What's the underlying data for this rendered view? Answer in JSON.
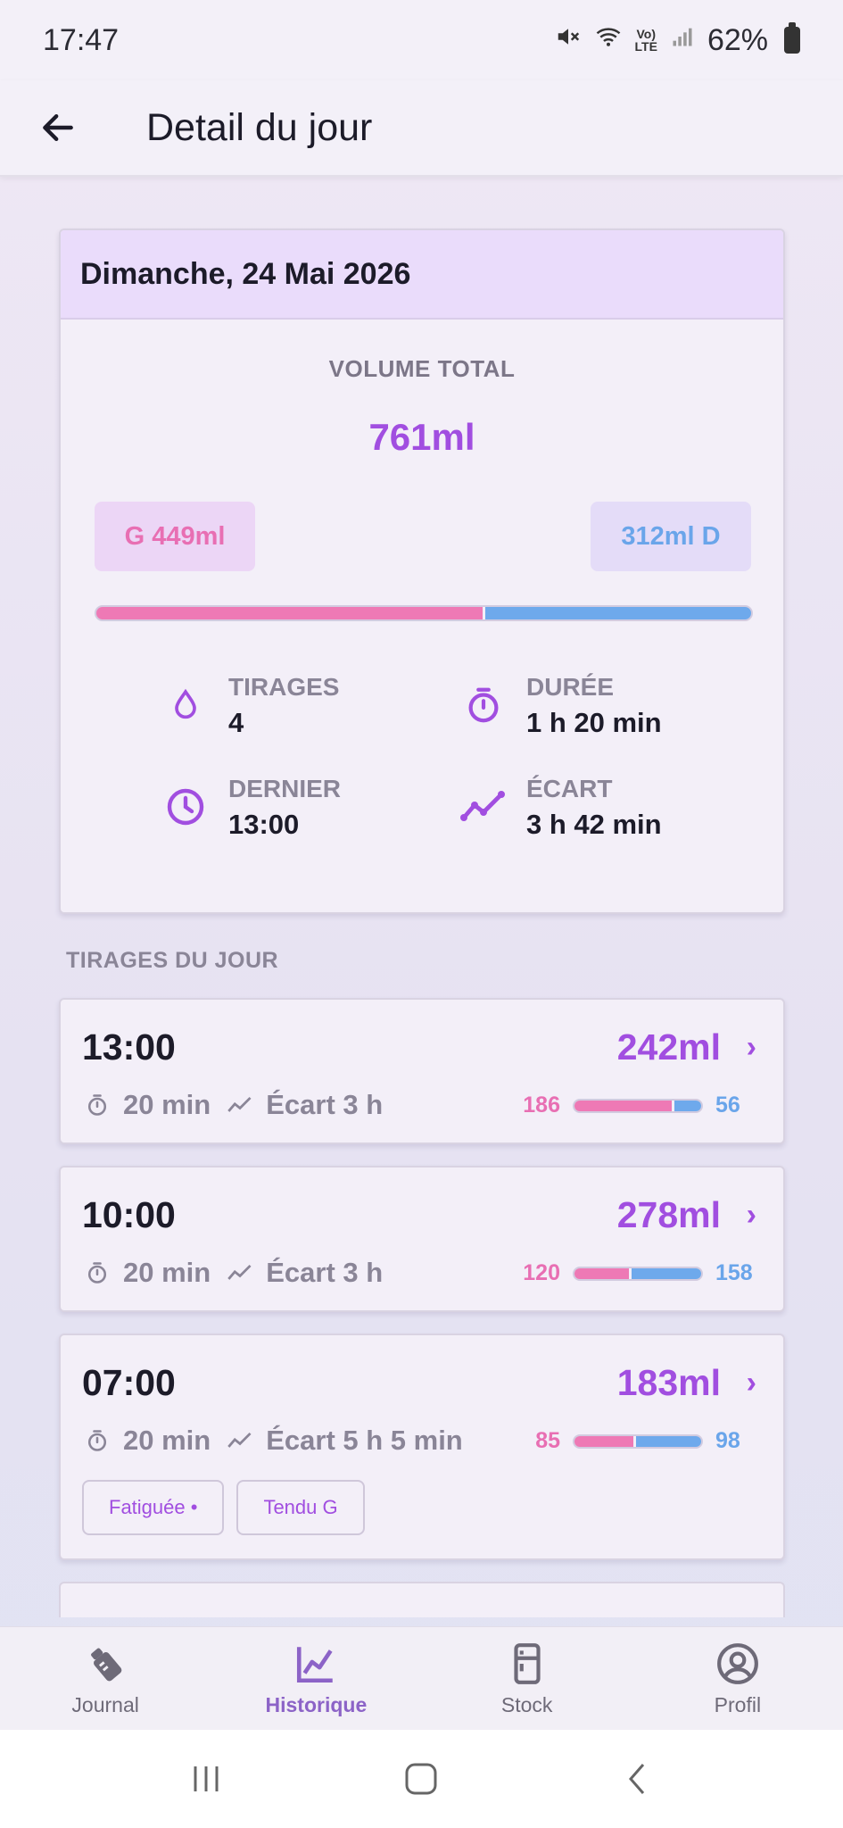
{
  "status_bar": {
    "time": "17:47",
    "battery": "62%",
    "icons": [
      "mute-icon",
      "wifi-icon",
      "volte-icon",
      "signal-icon",
      "battery-icon"
    ]
  },
  "app_bar": {
    "title": "Detail du jour"
  },
  "summary": {
    "date": "Dimanche, 24 Mai 2026",
    "total_label": "VOLUME TOTAL",
    "total_value": "761ml",
    "left_chip": "G 449ml",
    "right_chip": "312ml D",
    "left_ml": 449,
    "right_ml": 312,
    "stats": {
      "tirages": {
        "label": "TIRAGES",
        "value": "4"
      },
      "duree": {
        "label": "DURÉE",
        "value": "1 h 20 min"
      },
      "dernier": {
        "label": "DERNIER",
        "value": "13:00"
      },
      "ecart": {
        "label": "ÉCART",
        "value": "3 h 42 min"
      }
    }
  },
  "sessions_title": "TIRAGES DU JOUR",
  "sessions": [
    {
      "time": "13:00",
      "volume": "242ml",
      "chevron": "›",
      "duration": "20 min",
      "gap": "Écart 3 h",
      "left": "186",
      "right": "56",
      "left_n": 186,
      "right_n": 56
    },
    {
      "time": "10:00",
      "volume": "278ml",
      "chevron": "›",
      "duration": "20 min",
      "gap": "Écart 3 h",
      "left": "120",
      "right": "158",
      "left_n": 120,
      "right_n": 158
    },
    {
      "time": "07:00",
      "volume": "183ml",
      "chevron": "›",
      "duration": "20 min",
      "gap": "Écart 5 h 5 min",
      "left": "85",
      "right": "98",
      "left_n": 85,
      "right_n": 98,
      "tags": [
        "Fatiguée •",
        "Tendu G"
      ]
    }
  ],
  "bottom_nav": [
    {
      "label": "Journal",
      "icon": "bottle-icon",
      "active": false
    },
    {
      "label": "Historique",
      "icon": "chart-icon",
      "active": true
    },
    {
      "label": "Stock",
      "icon": "fridge-icon",
      "active": false
    },
    {
      "label": "Profil",
      "icon": "profile-icon",
      "active": false
    }
  ],
  "colors": {
    "accent": "#a14ee0",
    "left": "#ee79b5",
    "right": "#6ea9ec"
  }
}
